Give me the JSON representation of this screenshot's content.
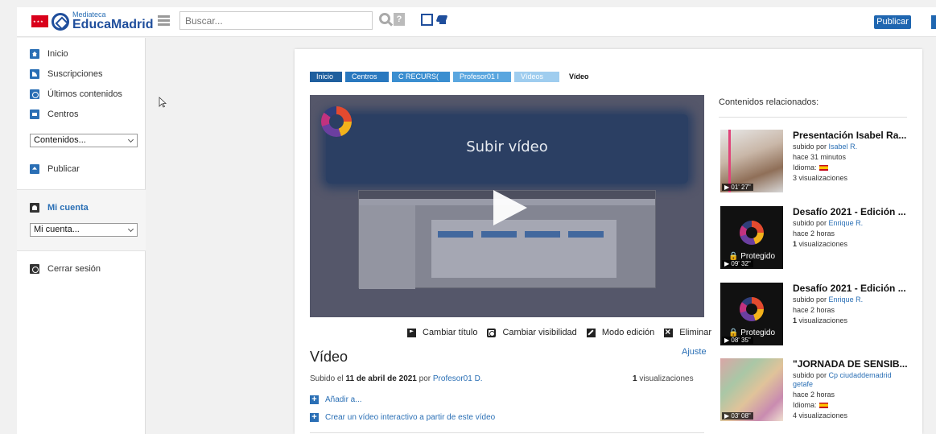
{
  "header": {
    "logo_sub": "Mediateca",
    "logo_main": "EducaMadrid",
    "search_placeholder": "Buscar...",
    "publish_label": "Publicar"
  },
  "sidebar": {
    "items": [
      {
        "label": "Inicio",
        "icon": "home-icon"
      },
      {
        "label": "Suscripciones",
        "icon": "rss-icon"
      },
      {
        "label": "Últimos contenidos",
        "icon": "clock-icon"
      },
      {
        "label": "Centros",
        "icon": "folder-icon"
      }
    ],
    "contents_select": "Contenidos...",
    "publish_label": "Publicar",
    "account_title": "Mi cuenta",
    "account_select": "Mi cuenta...",
    "logout_label": "Cerrar sesión"
  },
  "breadcrumb": [
    "Inicio",
    "Centros",
    "C RECURS(",
    "Profesor01 I",
    "Vídeos",
    "Vídeo"
  ],
  "player": {
    "banner_text": "Subir vídeo"
  },
  "actions": {
    "change_title": "Cambiar título",
    "change_visibility": "Cambiar visibilidad",
    "edit_mode": "Modo edición",
    "delete": "Eliminar"
  },
  "video": {
    "adjust_label": "Ajuste",
    "title": "Vídeo",
    "uploaded_prefix": "Subido el",
    "uploaded_date": "11 de abril de 2021",
    "uploaded_by_word": "por",
    "uploaded_author": "Profesor01 D.",
    "views_count": "1",
    "views_label": "visualizaciones",
    "add_to": "Añadir a...",
    "create_interactive": "Crear un vídeo interactivo a partir de este vídeo"
  },
  "related": {
    "heading": "Contenidos relacionados:",
    "items": [
      {
        "title": "Presentación Isabel Ra...",
        "uploaded_by": "subido por",
        "author": "Isabel R.",
        "time": "hace 31 minutos",
        "language_label": "Idioma:",
        "views": "3 visualizaciones",
        "duration": "01' 27\""
      },
      {
        "title": "Desafío 2021 - Edición ...",
        "uploaded_by": "subido por",
        "author": "Enrique R.",
        "time": "hace 2 horas",
        "views_count": "1",
        "views_label": "visualizaciones",
        "duration": "09' 32\"",
        "protected": "Protegido"
      },
      {
        "title": "Desafío 2021 - Edición ...",
        "uploaded_by": "subido por",
        "author": "Enrique R.",
        "time": "hace 2 horas",
        "views_count": "1",
        "views_label": "visualizaciones",
        "duration": "08' 35\"",
        "protected": "Protegido"
      },
      {
        "title": "\"JORNADA DE SENSIB...",
        "uploaded_by": "subido por",
        "author": "Cp ciudaddemadrid getafe",
        "time": "hace 2 horas",
        "language_label": "Idioma:",
        "views": "4 visualizaciones",
        "duration": "03' 08\""
      }
    ]
  }
}
